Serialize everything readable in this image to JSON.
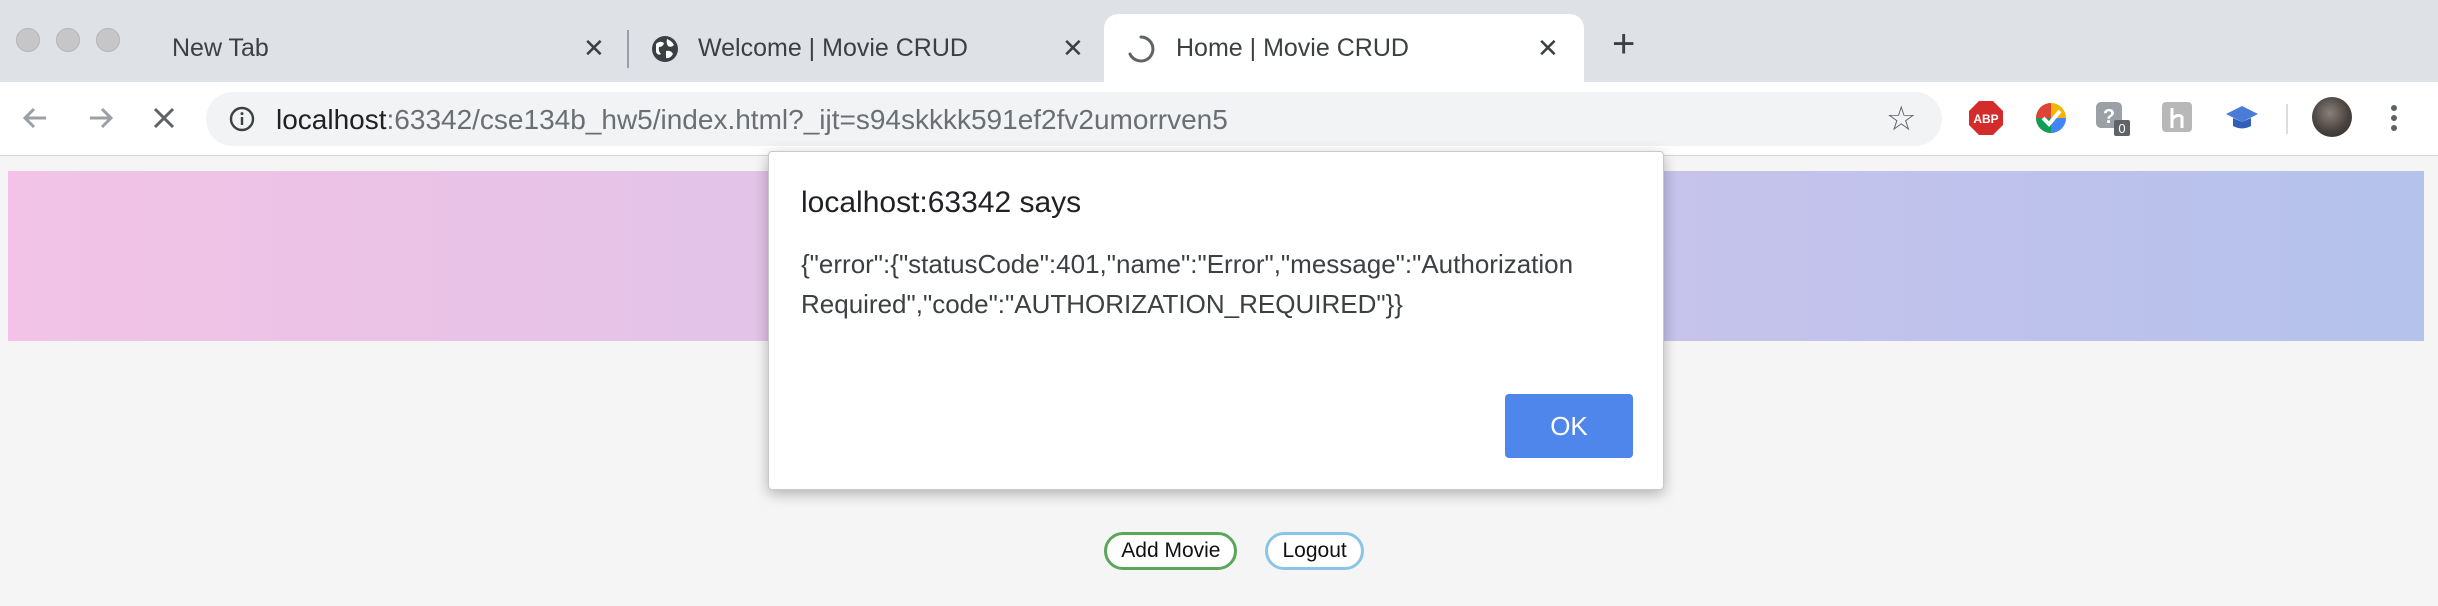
{
  "tabs": [
    {
      "title": "New Tab",
      "active": false
    },
    {
      "title": "Welcome | Movie CRUD",
      "active": false
    },
    {
      "title": "Home | Movie CRUD",
      "active": true
    }
  ],
  "newtab_symbol": "+",
  "close_symbol": "✕",
  "address_bar": {
    "host": "localhost",
    "path": ":63342/cse134b_hw5/index.html?_ijt=s94skkkk591ef2fv2umorrven5"
  },
  "extensions": {
    "abp_label": "ABP",
    "badge_count": "0"
  },
  "page": {
    "add_movie_label": "Add Movie",
    "logout_label": "Logout"
  },
  "dialog": {
    "title": "localhost:63342 says",
    "message": "{\"error\":{\"statusCode\":401,\"name\":\"Error\",\"message\":\"Authorization\nRequired\",\"code\":\"AUTHORIZATION_REQUIRED\"}}",
    "ok_label": "OK"
  },
  "colors": {
    "ok_button": "#4f86ec",
    "add_movie_border": "#5ca65c",
    "logout_border": "#8ac4e6",
    "banner_start": "#f2c3e6",
    "banner_end": "#b4c2ec"
  },
  "icons": [
    "globe-icon",
    "loading-spinner-icon",
    "back-arrow-icon",
    "forward-arrow-icon",
    "stop-icon",
    "info-icon",
    "star-icon",
    "adblock-icon",
    "extension-icon",
    "avatar",
    "menu-icon"
  ]
}
